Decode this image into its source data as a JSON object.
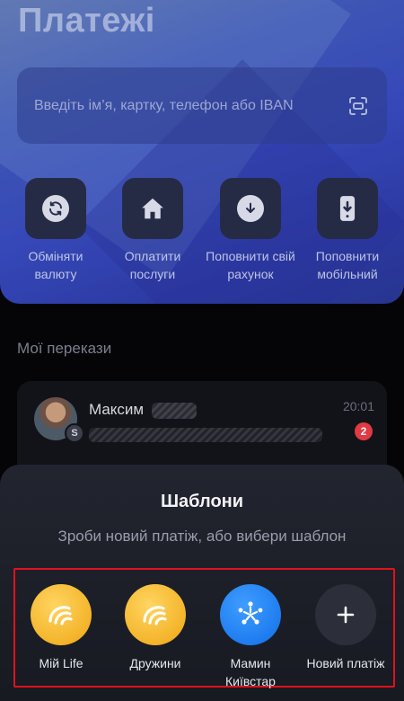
{
  "header": {
    "title": "Платежі"
  },
  "search": {
    "placeholder": "Введіть ім’я, картку, телефон або IBAN"
  },
  "quick_actions": [
    {
      "label": "Обміняти валюту",
      "icon": "exchange-icon"
    },
    {
      "label": "Оплатити послуги",
      "icon": "home-icon"
    },
    {
      "label": "Поповнити свій рахунок",
      "icon": "download-icon"
    },
    {
      "label": "Поповнити мобільний",
      "icon": "phone-icon"
    }
  ],
  "transfers": {
    "title": "Мої перекази",
    "items": [
      {
        "name": "Максим",
        "avatar_badge": "S",
        "time": "20:01",
        "unread": "2"
      }
    ]
  },
  "sheet": {
    "title": "Шаблони",
    "subtitle": "Зроби новий платіж,  або вибери шаблон",
    "templates": [
      {
        "label": "Мій Life",
        "icon": "life-logo-icon",
        "color": "#f4b42a"
      },
      {
        "label": "Дружини",
        "icon": "life-logo-icon",
        "color": "#f4b42a"
      },
      {
        "label": "Мамин Київстар",
        "icon": "kyivstar-logo-icon",
        "color": "#1f7cf0"
      },
      {
        "label": "Новий платіж",
        "icon": "plus-icon",
        "color": "#2c2f3a"
      }
    ]
  },
  "colors": {
    "highlight_border": "#e0121c",
    "badge_red": "#e03a45"
  }
}
